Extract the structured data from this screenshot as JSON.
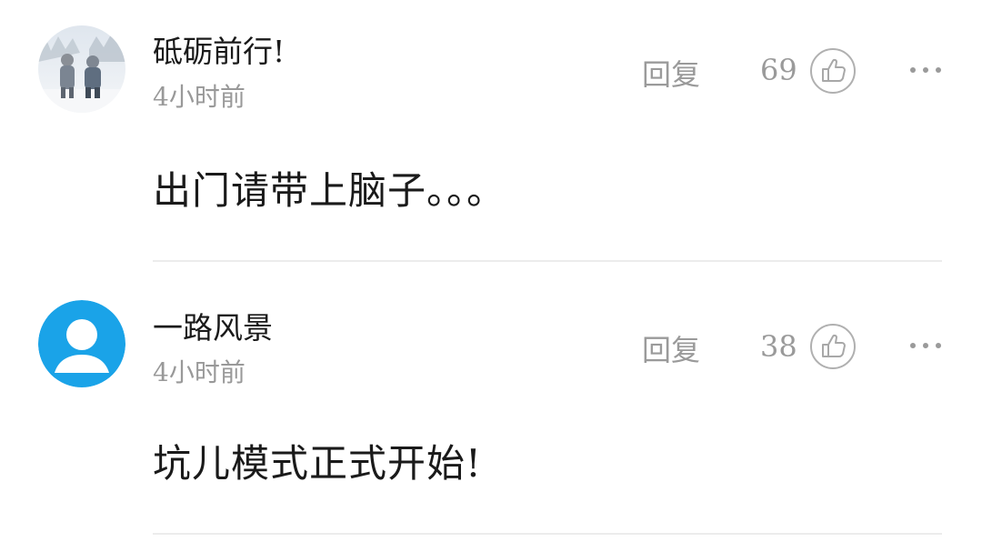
{
  "comments": [
    {
      "username": "砥砺前行!",
      "time": "4小时前",
      "reply_label": "回复",
      "likes": "69",
      "text": "出门请带上脑子。。。",
      "avatar_type": "photo-snow-children"
    },
    {
      "username": "一路风景",
      "time": "4小时前",
      "reply_label": "回复",
      "likes": "38",
      "text": "坑儿模式正式开始!",
      "avatar_type": "default-person"
    }
  ],
  "colors": {
    "default_avatar": "#1aa3e8",
    "muted_text": "#999999",
    "primary_text": "#1a1a1a",
    "divider": "#ececec"
  },
  "icons": {
    "like": "thumbs-up-icon",
    "more": "more-dots-icon"
  }
}
